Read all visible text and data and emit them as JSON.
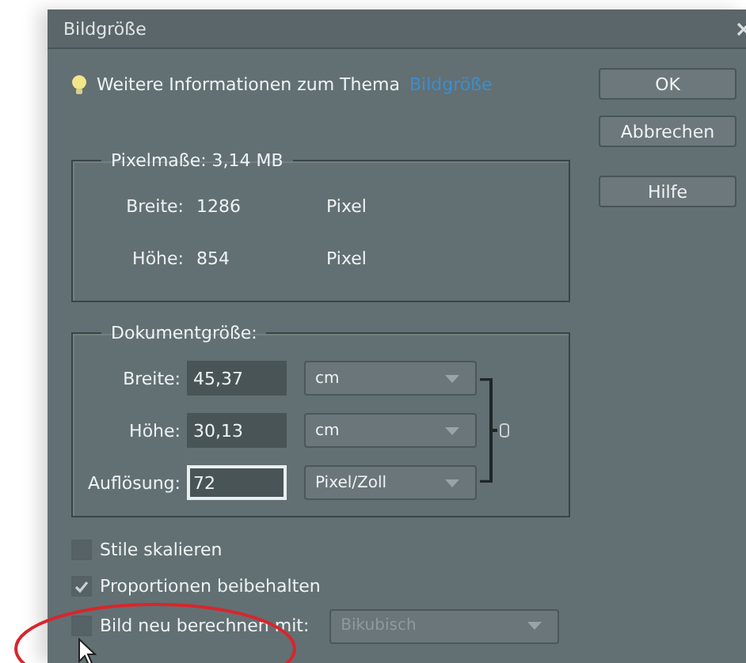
{
  "window": {
    "title": "Bildgröße"
  },
  "info": {
    "text": "Weitere Informationen zum Thema",
    "link": "Bildgröße"
  },
  "buttons": [
    {
      "label": "OK"
    },
    {
      "label": "Abbrechen"
    },
    {
      "label": "Hilfe"
    }
  ],
  "pixel_dimensions": {
    "title": "Pixelmaße: 3,14 MB",
    "rows": [
      {
        "label": "Breite:",
        "value": "1286",
        "unit": "Pixel"
      },
      {
        "label": "Höhe:",
        "value": "854",
        "unit": "Pixel"
      }
    ]
  },
  "document_size": {
    "title": "Dokumentgröße:",
    "linked": true,
    "rows": [
      {
        "label": "Breite:",
        "value": "45,37",
        "unit": "cm",
        "focused": false
      },
      {
        "label": "Höhe:",
        "value": "30,13",
        "unit": "cm",
        "focused": false
      },
      {
        "label": "Auflösung:",
        "value": "72",
        "unit": "Pixel/Zoll",
        "focused": true
      }
    ]
  },
  "options": [
    {
      "label": "Stile skalieren",
      "checked": false
    },
    {
      "label": "Proportionen beibehalten",
      "checked": true
    },
    {
      "label": "Bild neu berechnen mit:",
      "checked": false,
      "dropdown": {
        "value": "Bikubisch",
        "disabled": true
      }
    }
  ]
}
